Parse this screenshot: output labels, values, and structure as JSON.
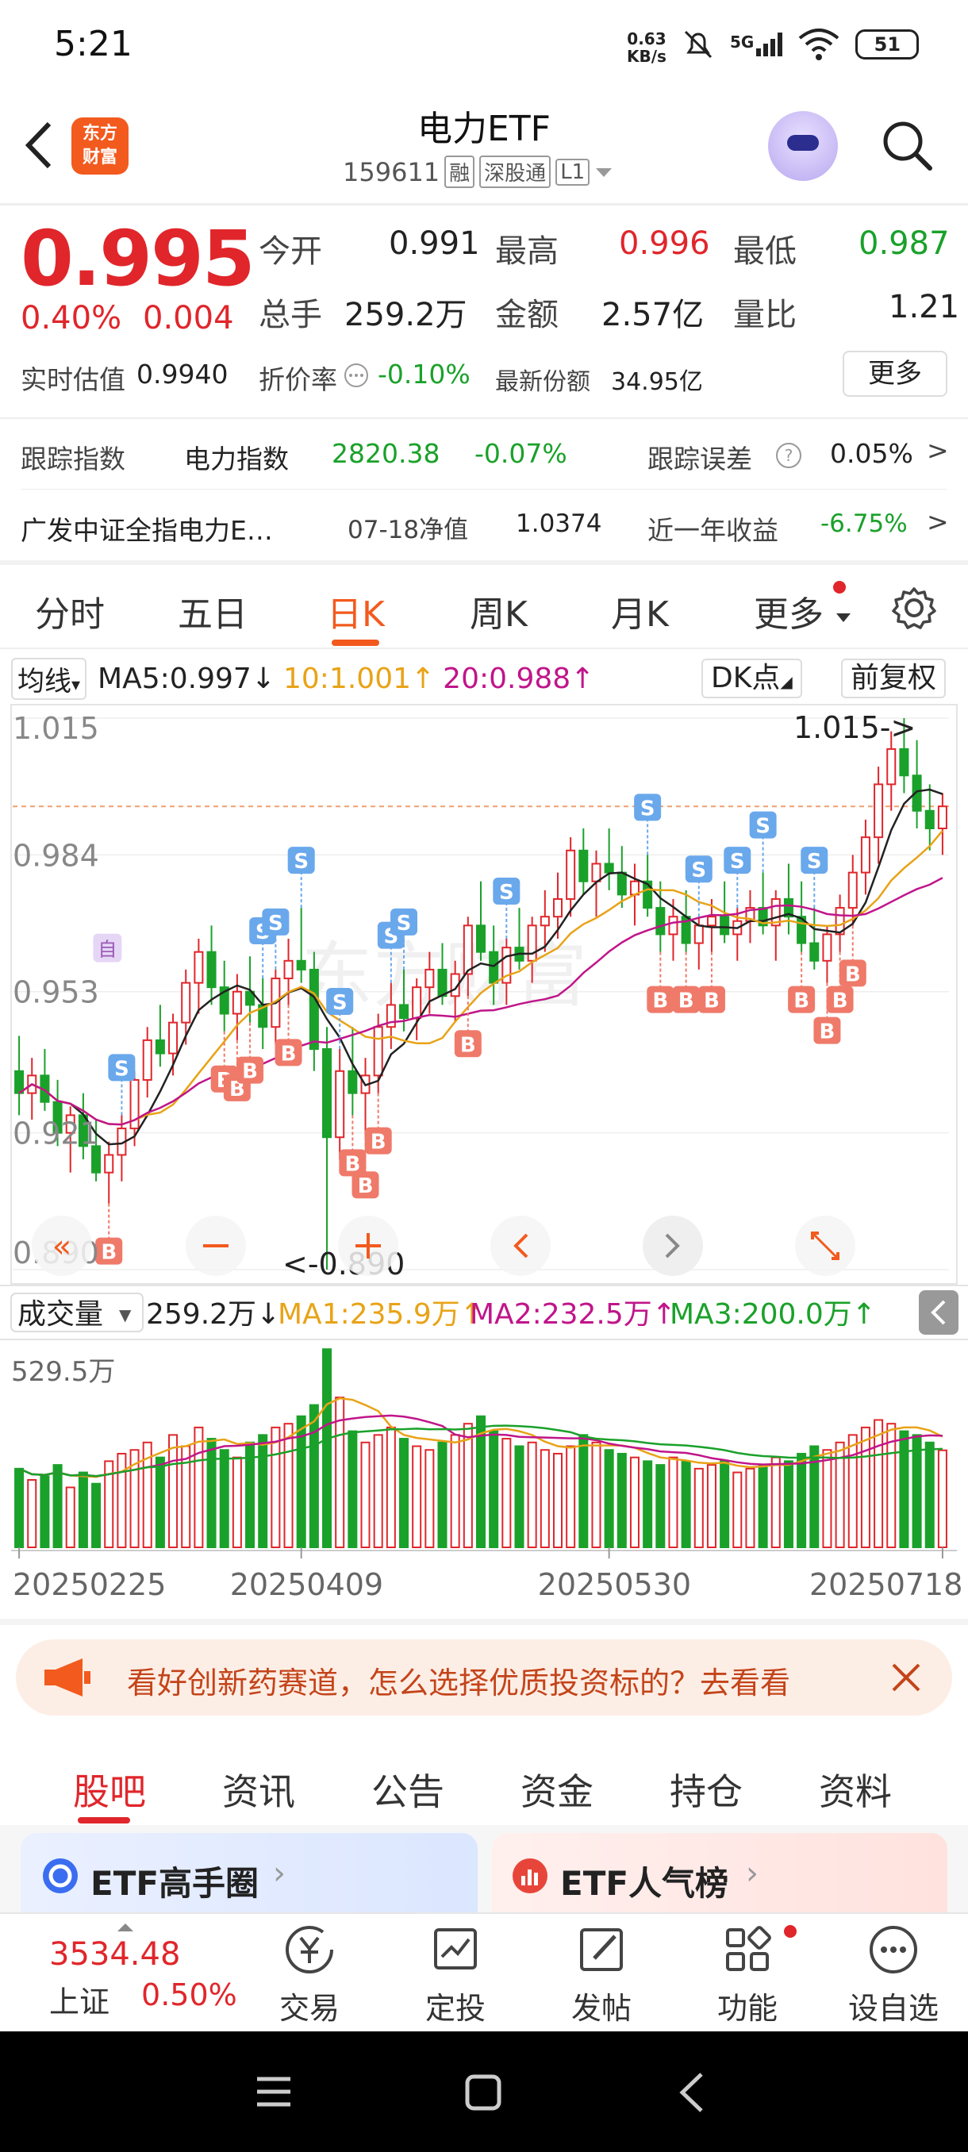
{
  "status": {
    "time": "5:21",
    "netspeed_value": "0.63",
    "netspeed_unit": "KB/s",
    "network": "5G",
    "battery": "51"
  },
  "header": {
    "logo_line1": "东方",
    "logo_line2": "财富",
    "title": "电力ETF",
    "code": "159611",
    "tag_margin": "融",
    "tag_connect": "深股通",
    "tag_level": "L1"
  },
  "quote": {
    "price": "0.995",
    "change_pct": "0.40%",
    "change": "0.004",
    "open_label": "今开",
    "open": "0.991",
    "high_label": "最高",
    "high": "0.996",
    "low_label": "最低",
    "low": "0.987",
    "volume_label": "总手",
    "volume": "259.2万",
    "amount_label": "金额",
    "amount": "2.57亿",
    "volratio_label": "量比",
    "volratio": "1.21",
    "iopv_label": "实时估值",
    "iopv": "0.9940",
    "discount_label": "折价率",
    "discount": "-0.10%",
    "shares_label": "最新份额",
    "shares": "34.95亿",
    "more_label": "更多"
  },
  "tracking": {
    "index_label": "跟踪指数",
    "index_name": "电力指数",
    "index_value": "2820.38",
    "index_change": "-0.07%",
    "error_label": "跟踪误差",
    "error_value": "0.05%",
    "fund_name": "广发中证全指电力E…",
    "nav_label": "07-18净值",
    "nav_value": "1.0374",
    "year_label": "近一年收益",
    "year_value": "-6.75%"
  },
  "ktabs": [
    "分时",
    "五日",
    "日K",
    "周K",
    "月K",
    "更多"
  ],
  "ma": {
    "selector": "均线",
    "ma5": "MA5:0.997",
    "ma10": "10:1.001",
    "ma20": "20:0.988",
    "dk": "DK点",
    "adjust": "前复权"
  },
  "chart_data": {
    "type": "candlestick",
    "price_axis": [
      "1.015",
      "0.984",
      "0.953",
      "0.921",
      "0.890"
    ],
    "high_label": "1.015->",
    "low_label": "<-0.890",
    "volume_selector": "成交量",
    "volume_value": "259.2万",
    "vol_ma1": "MA1:235.9万",
    "vol_ma2": "MA2:232.5万",
    "vol_ma3": "MA3:200.0万",
    "volume_max": "529.5万",
    "dates": [
      "20250225",
      "20250409",
      "20250530",
      "20250718"
    ],
    "marker_self": "自",
    "marker_buy": "B",
    "marker_sell": "S",
    "candles": [
      [
        0.935,
        0.943,
        0.925,
        0.93
      ],
      [
        0.93,
        0.938,
        0.924,
        0.934
      ],
      [
        0.934,
        0.94,
        0.926,
        0.928
      ],
      [
        0.928,
        0.933,
        0.918,
        0.921
      ],
      [
        0.921,
        0.927,
        0.912,
        0.925
      ],
      [
        0.925,
        0.93,
        0.915,
        0.918
      ],
      [
        0.918,
        0.924,
        0.91,
        0.912
      ],
      [
        0.912,
        0.919,
        0.905,
        0.916
      ],
      [
        0.916,
        0.925,
        0.91,
        0.922
      ],
      [
        0.922,
        0.935,
        0.918,
        0.933
      ],
      [
        0.933,
        0.945,
        0.929,
        0.942
      ],
      [
        0.942,
        0.95,
        0.936,
        0.939
      ],
      [
        0.939,
        0.948,
        0.934,
        0.946
      ],
      [
        0.946,
        0.958,
        0.941,
        0.955
      ],
      [
        0.955,
        0.965,
        0.948,
        0.962
      ],
      [
        0.962,
        0.968,
        0.95,
        0.954
      ],
      [
        0.954,
        0.96,
        0.944,
        0.948
      ],
      [
        0.948,
        0.957,
        0.942,
        0.953
      ],
      [
        0.953,
        0.961,
        0.946,
        0.95
      ],
      [
        0.95,
        0.956,
        0.94,
        0.945
      ],
      [
        0.945,
        0.958,
        0.941,
        0.956
      ],
      [
        0.956,
        0.965,
        0.95,
        0.96
      ],
      [
        0.96,
        0.972,
        0.955,
        0.958
      ],
      [
        0.958,
        0.962,
        0.935,
        0.94
      ],
      [
        0.94,
        0.945,
        0.89,
        0.92
      ],
      [
        0.92,
        0.94,
        0.915,
        0.935
      ],
      [
        0.935,
        0.945,
        0.925,
        0.93
      ],
      [
        0.93,
        0.938,
        0.92,
        0.934
      ],
      [
        0.934,
        0.948,
        0.93,
        0.945
      ],
      [
        0.945,
        0.955,
        0.94,
        0.95
      ],
      [
        0.95,
        0.958,
        0.944,
        0.947
      ],
      [
        0.947,
        0.956,
        0.942,
        0.954
      ],
      [
        0.954,
        0.962,
        0.948,
        0.958
      ],
      [
        0.958,
        0.964,
        0.95,
        0.952
      ],
      [
        0.952,
        0.96,
        0.946,
        0.957
      ],
      [
        0.957,
        0.97,
        0.952,
        0.968
      ],
      [
        0.968,
        0.978,
        0.96,
        0.962
      ],
      [
        0.962,
        0.968,
        0.95,
        0.955
      ],
      [
        0.955,
        0.965,
        0.95,
        0.963
      ],
      [
        0.963,
        0.972,
        0.958,
        0.96
      ],
      [
        0.96,
        0.97,
        0.955,
        0.968
      ],
      [
        0.968,
        0.976,
        0.962,
        0.97
      ],
      [
        0.97,
        0.98,
        0.965,
        0.974
      ],
      [
        0.974,
        0.988,
        0.97,
        0.985
      ],
      [
        0.985,
        0.99,
        0.975,
        0.978
      ],
      [
        0.978,
        0.985,
        0.97,
        0.982
      ],
      [
        0.982,
        0.99,
        0.976,
        0.98
      ],
      [
        0.98,
        0.986,
        0.972,
        0.975
      ],
      [
        0.975,
        0.982,
        0.968,
        0.978
      ],
      [
        0.978,
        0.984,
        0.97,
        0.972
      ],
      [
        0.972,
        0.978,
        0.962,
        0.966
      ],
      [
        0.966,
        0.974,
        0.96,
        0.97
      ],
      [
        0.97,
        0.976,
        0.962,
        0.964
      ],
      [
        0.964,
        0.97,
        0.958,
        0.968
      ],
      [
        0.968,
        0.974,
        0.962,
        0.97
      ],
      [
        0.97,
        0.978,
        0.964,
        0.966
      ],
      [
        0.966,
        0.972,
        0.96,
        0.969
      ],
      [
        0.969,
        0.976,
        0.964,
        0.972
      ],
      [
        0.972,
        0.98,
        0.966,
        0.968
      ],
      [
        0.968,
        0.976,
        0.96,
        0.974
      ],
      [
        0.974,
        0.982,
        0.966,
        0.97
      ],
      [
        0.97,
        0.978,
        0.962,
        0.964
      ],
      [
        0.964,
        0.972,
        0.958,
        0.96
      ],
      [
        0.96,
        0.968,
        0.955,
        0.966
      ],
      [
        0.966,
        0.975,
        0.962,
        0.972
      ],
      [
        0.972,
        0.984,
        0.968,
        0.98
      ],
      [
        0.98,
        0.992,
        0.975,
        0.988
      ],
      [
        0.988,
        1.004,
        0.982,
        1.0
      ],
      [
        1.0,
        1.012,
        0.994,
        1.008
      ],
      [
        1.008,
        1.015,
        0.998,
        1.002
      ],
      [
        1.002,
        1.01,
        0.99,
        0.994
      ],
      [
        0.994,
        1.0,
        0.985,
        0.99
      ],
      [
        0.99,
        0.998,
        0.984,
        0.995
      ]
    ],
    "volumes": [
      210,
      180,
      190,
      220,
      160,
      200,
      170,
      230,
      250,
      260,
      280,
      240,
      300,
      270,
      320,
      290,
      260,
      240,
      280,
      300,
      320,
      330,
      350,
      380,
      529,
      400,
      310,
      280,
      300,
      320,
      290,
      270,
      260,
      280,
      300,
      330,
      350,
      310,
      290,
      270,
      280,
      260,
      250,
      270,
      300,
      280,
      260,
      250,
      240,
      230,
      220,
      240,
      230,
      210,
      220,
      230,
      200,
      210,
      220,
      240,
      230,
      250,
      270,
      260,
      280,
      300,
      320,
      340,
      330,
      310,
      300,
      280,
      259
    ],
    "buy_marks": [
      7,
      16,
      17,
      18,
      21,
      26,
      27,
      28,
      35,
      50,
      52,
      54,
      61,
      63,
      64,
      65
    ],
    "sell_marks": [
      8,
      19,
      20,
      22,
      25,
      29,
      30,
      38,
      49,
      53,
      56,
      58,
      62
    ]
  },
  "banner": {
    "text": "看好创新药赛道，怎么选择优质投资标的？去看看"
  },
  "btabs": [
    "股吧",
    "资讯",
    "公告",
    "资金",
    "持仓",
    "资料"
  ],
  "cards": {
    "left_title": "ETF高手圈",
    "right_title": "ETF人气榜"
  },
  "bottom_nav": {
    "index_value": "3534.48",
    "index_name": "上证",
    "index_change": "0.50%",
    "trade": "交易",
    "invest": "定投",
    "post": "发帖",
    "features": "功能",
    "watchlist": "设自选"
  }
}
